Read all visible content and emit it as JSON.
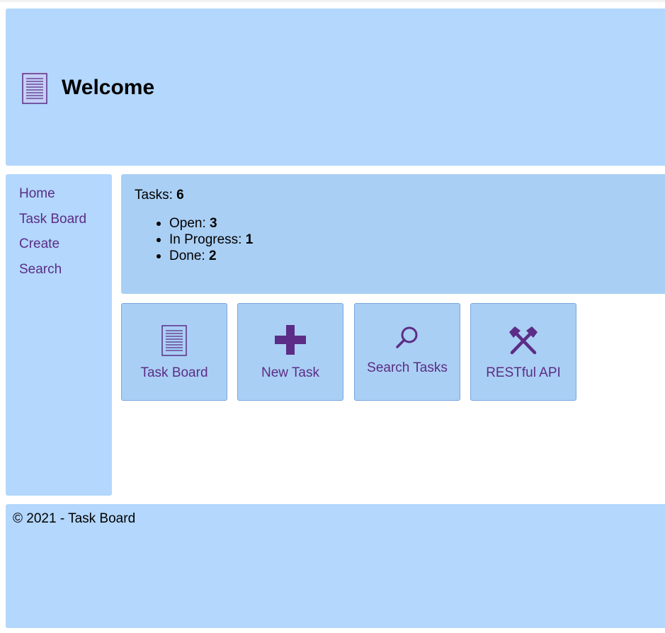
{
  "header": {
    "title": "Welcome",
    "icon": "document-icon"
  },
  "nav": {
    "items": [
      {
        "label": "Home"
      },
      {
        "label": "Task Board"
      },
      {
        "label": "Create"
      },
      {
        "label": "Search"
      }
    ]
  },
  "summary": {
    "tasks_label": "Tasks:",
    "tasks_count": "6",
    "statuses": [
      {
        "label": "Open:",
        "count": "3"
      },
      {
        "label": "In Progress:",
        "count": "1"
      },
      {
        "label": "Done:",
        "count": "2"
      }
    ]
  },
  "tiles": [
    {
      "label": "Task Board",
      "icon": "document-icon"
    },
    {
      "label": "New Task",
      "icon": "plus-icon"
    },
    {
      "label": "Search Tasks",
      "icon": "search-icon"
    },
    {
      "label": "RESTful API",
      "icon": "hammers-icon"
    }
  ],
  "footer": {
    "copyright": "© 2021 - Task Board"
  },
  "colors": {
    "panel": "#b3d7fd",
    "panel_dark": "#aacff4",
    "link": "#5b2d86",
    "icon": "#5b2d86"
  }
}
